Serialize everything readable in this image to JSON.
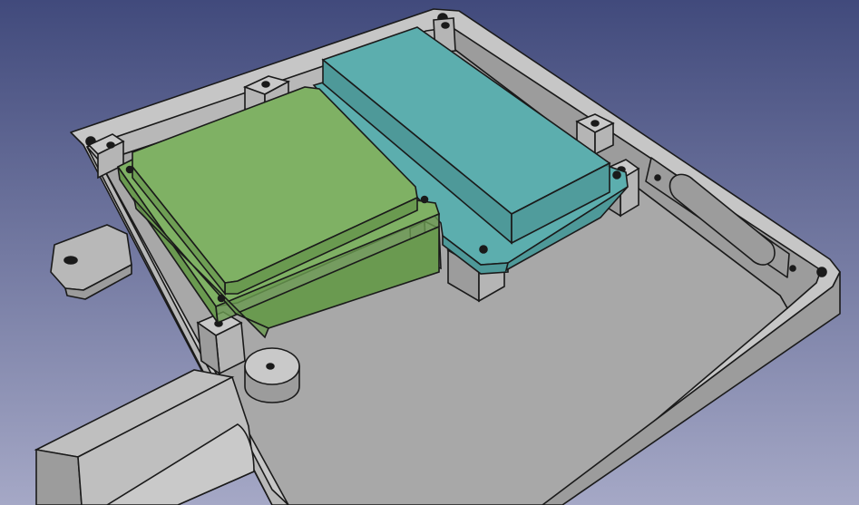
{
  "view": {
    "background_top": "#414a7c",
    "background_bottom": "#a5a8c6",
    "edge_color": "#1a1a1a"
  },
  "colors": {
    "enclosure_wall": "#b8b8b8",
    "enclosure_wall_shade": "#9c9c9c",
    "enclosure_floor": "#a8a8a8",
    "enclosure_rim": "#c6c6c6",
    "green_module_top": "#7fb164",
    "green_module_side": "#6a9a50",
    "cyan_module_top": "#5caeae",
    "cyan_module_side": "#4e9999",
    "standoff": "#b5b5b5",
    "standoff_top": "#c9c9c9",
    "pipe": "#bfbfbf"
  },
  "scene": {
    "objects": [
      {
        "name": "enclosure-box",
        "color_key": "enclosure_wall"
      },
      {
        "name": "green-module",
        "color_key": "green_module_top"
      },
      {
        "name": "cyan-module",
        "color_key": "cyan_module_top"
      },
      {
        "name": "mounting-standoff",
        "color_key": "standoff"
      },
      {
        "name": "cable-port",
        "color_key": "enclosure_wall_shade"
      },
      {
        "name": "mounting-tab",
        "color_key": "enclosure_wall"
      },
      {
        "name": "pipe-fitting",
        "color_key": "pipe"
      }
    ]
  }
}
